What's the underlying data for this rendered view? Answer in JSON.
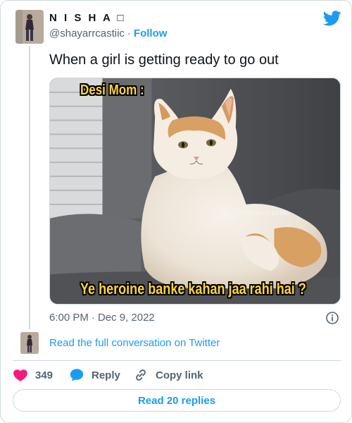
{
  "user": {
    "display_name": "N I S H A □",
    "handle": "@shayarrcastiic",
    "separator": "·",
    "follow_label": "Follow"
  },
  "tweet": {
    "text": "When a girl is getting ready to go out",
    "time": "6:00 PM",
    "date": "Dec 9, 2022",
    "date_separator": "·"
  },
  "media": {
    "caption_top": "Desi Mom :",
    "caption_bottom": "Ye heroine banke kahan jaa rahi hai ?",
    "watermark": "@shayarrcastiic"
  },
  "conversation": {
    "link_label": "Read the full conversation on Twitter"
  },
  "actions": {
    "like_count": "349",
    "reply_label": "Reply",
    "copy_label": "Copy link"
  },
  "replies_button": "Read 20 replies",
  "colors": {
    "accent": "#1d9bf0",
    "like": "#f91880",
    "muted": "#536471",
    "border": "#cfd9de"
  },
  "icons": [
    "twitter-bird-icon",
    "info-icon",
    "heart-icon",
    "reply-bubble-icon",
    "link-icon"
  ]
}
